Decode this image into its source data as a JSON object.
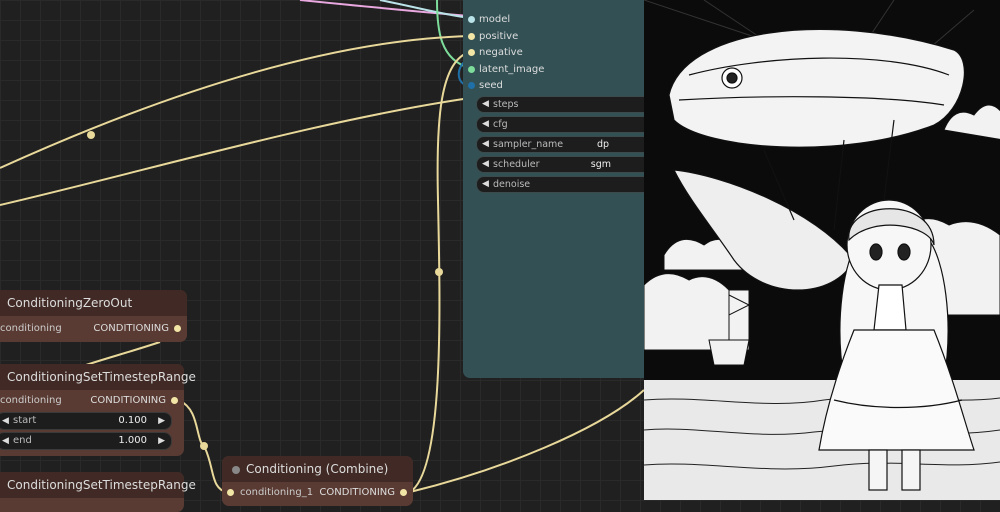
{
  "ksampler": {
    "inputs": [
      {
        "label": "model",
        "color": "#b9e3e8"
      },
      {
        "label": "positive",
        "color": "#f1e6a6"
      },
      {
        "label": "negative",
        "color": "#f1e6a6"
      },
      {
        "label": "latent_image",
        "color": "#f7b0d5"
      },
      {
        "label": "seed",
        "color": "#1f6fa8"
      }
    ],
    "widgets": [
      {
        "label": "steps",
        "value": ""
      },
      {
        "label": "cfg",
        "value": ""
      },
      {
        "label": "sampler_name",
        "value": "dp"
      },
      {
        "label": "scheduler",
        "value": "sgm"
      },
      {
        "label": "denoise",
        "value": ""
      }
    ]
  },
  "zero_out": {
    "title": "ConditioningZeroOut",
    "input": "conditioning",
    "output": "CONDITIONING"
  },
  "timestep_range_1": {
    "title": "ConditioningSetTimestepRange",
    "input": "conditioning",
    "output": "CONDITIONING",
    "start_label": "start",
    "start_value": "0.100",
    "end_label": "end",
    "end_value": "1.000"
  },
  "timestep_range_2": {
    "title": "ConditioningSetTimestepRange"
  },
  "combine": {
    "title": "Conditioning (Combine)",
    "input": "conditioning_1",
    "output": "CONDITIONING"
  },
  "icons": {
    "left_arrow": "◀",
    "right_arrow": "▶"
  },
  "colors": {
    "conditioning_wire": "#e8d89a",
    "latent_wire": "#7ddc9a",
    "model_wire": "#b9e3e8",
    "pink_wire": "#e9a8e0",
    "ksampler_bg": "#335155",
    "node_brown": "#5a3b33"
  }
}
